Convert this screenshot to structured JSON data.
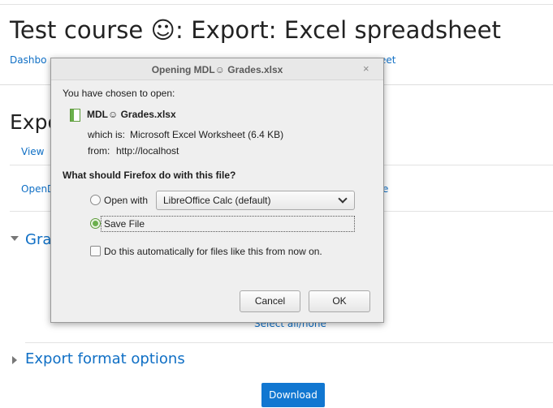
{
  "page": {
    "title": "Test course ☺: Export: Excel spreadsheet",
    "breadcrumb_left": "Dashbo",
    "breadcrumb_right": "eet",
    "subtitle": "Expo",
    "tab_view": "View",
    "tab_opendoc": "OpenD",
    "tab_e": "e",
    "section_grades": "Gra",
    "select_all": "Select all/none",
    "section_export_format": "Export format options",
    "download_button": "Download"
  },
  "dialog": {
    "title": "Opening MDL☺ Grades.xlsx",
    "chosen_text": "You have chosen to open:",
    "file_name": "MDL☺ Grades.xlsx",
    "which_is_label": "which is:",
    "which_is_value": "Microsoft Excel Worksheet (6.4 KB)",
    "from_label": "from:",
    "from_value": "http://localhost",
    "question": "What should Firefox do with this file?",
    "open_with_label": "Open with",
    "open_with_app": "LibreOffice Calc (default)",
    "save_file_label": "Save File",
    "auto_label": "Do this automatically for files like this from now on.",
    "cancel_button": "Cancel",
    "ok_button": "OK",
    "close_glyph": "×",
    "selected_option": "save_file",
    "auto_checked": false
  },
  "colors": {
    "link": "#0f6fc5",
    "download_bg": "#1177d1",
    "radio_selected": "#6ab04c"
  },
  "icons": {
    "file": "spreadsheet-file-icon",
    "close": "close-icon",
    "chevron": "chevron-down-icon",
    "caret_expanded": "caret-down-icon",
    "caret_collapsed": "caret-right-icon"
  }
}
